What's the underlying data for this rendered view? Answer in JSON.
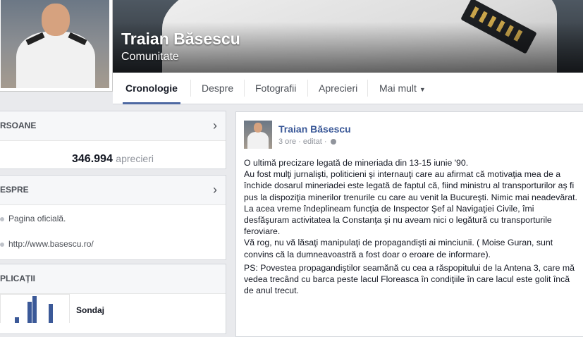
{
  "page": {
    "name": "Traian Băsescu",
    "category": "Comunitate"
  },
  "tabs": [
    {
      "label": "Cronologie",
      "active": true
    },
    {
      "label": "Despre",
      "active": false
    },
    {
      "label": "Fotografii",
      "active": false
    },
    {
      "label": "Aprecieri",
      "active": false
    },
    {
      "label": "Mai mult",
      "active": false
    }
  ],
  "sidebar": {
    "people": {
      "heading": "RSOANE",
      "likes_count": "346.994",
      "likes_label": "aprecieri"
    },
    "about": {
      "heading": "ESPRE",
      "items": [
        {
          "label": "Pagina oficială."
        },
        {
          "label": "http://www.basescu.ro/"
        }
      ]
    },
    "apps": {
      "heading": "PLICAȚII",
      "item_label": "Sondaj",
      "thumbnail_bars": [
        0.2,
        0.8,
        1.0,
        0.7
      ]
    }
  },
  "post": {
    "author": "Traian Băsescu",
    "time": "3 ore",
    "edited": "editat",
    "paragraphs": [
      "O ultimă precizare legată de mineriada din 13-15 iunie '90.",
      "Au fost mulţi jurnalişti, politicieni şi internauţi care au afirmat că motivaţia mea de a închide dosarul mineriadei este legată de faptul că, fiind ministru al transporturilor aş fi pus la dispoziţia minerilor trenurile cu care au venit la Bucureşti. Nimic mai neadevărat.",
      "La acea vreme îndeplineam funcţia de Inspector Şef al Navigaţiei Civile, îmi desfăşuram activitatea la Constanţa şi nu aveam nici o legătură cu transporturile feroviare.",
      "Vă rog, nu vă lăsaţi manipulaţi de propagandişti ai minciunii. ( Moise Guran, sunt convins că la dumneavoastră a fost doar o eroare de informare).",
      "PS: Povestea propagandiştilor seamănă cu cea a răspopitului de la Antena 3, care mă vedea trecând cu barca peste lacul Floreasca în condiţiile în care lacul este golit încă de anul trecut."
    ]
  },
  "colors": {
    "link": "#3b5998",
    "tab_underline": "#4e69a2",
    "page_bg": "#e9eaed"
  }
}
